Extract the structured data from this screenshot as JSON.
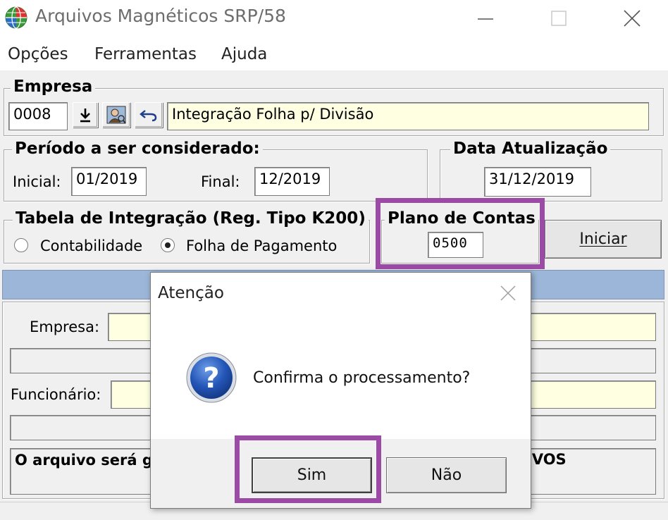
{
  "window": {
    "title": "Arquivos Magnéticos SRP/58"
  },
  "menu": {
    "items": [
      "Opções",
      "Ferramentas",
      "Ajuda"
    ]
  },
  "empresa": {
    "legend": "Empresa",
    "code": "0008",
    "name": "Integração Folha p/ Divisão"
  },
  "periodo": {
    "legend": "Período a ser considerado:",
    "inicial_label": "Inicial:",
    "inicial_value": "01/2019",
    "final_label": "Final:",
    "final_value": "12/2019"
  },
  "data_atualizacao": {
    "legend": "Data Atualização",
    "value": "31/12/2019"
  },
  "tabela": {
    "legend": "Tabela de Integração (Reg. Tipo K200)",
    "options": [
      {
        "label": "Contabilidade",
        "selected": false
      },
      {
        "label": "Folha de Pagamento",
        "selected": true
      }
    ]
  },
  "plano": {
    "legend": "Plano de Contas",
    "value": "0500"
  },
  "iniciar_label": "Iniciar",
  "progress": {
    "empresa_label": "Empresa:",
    "funcionario_label": "Funcionário:",
    "message_left": "O arquivo será g",
    "message_right": "IVOS"
  },
  "dialog": {
    "title": "Atenção",
    "message": "Confirma o processamento?",
    "yes_label": "Sim",
    "no_label": "Não"
  },
  "colors": {
    "highlight": "#9b4aa6",
    "panel_header": "#9bb6d8",
    "yellow_field": "#ffffe1"
  }
}
